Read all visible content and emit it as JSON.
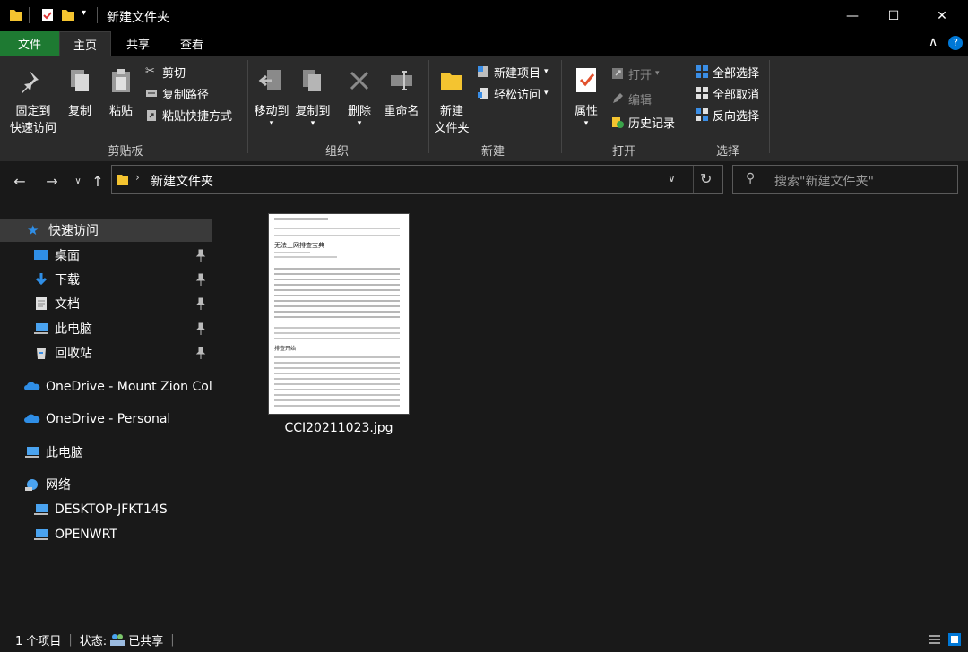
{
  "window": {
    "title": "新建文件夹",
    "controls": {
      "minimize": "—",
      "maximize": "☐",
      "close": "✕"
    }
  },
  "tabs": [
    {
      "label": "文件"
    },
    {
      "label": "主页"
    },
    {
      "label": "共享"
    },
    {
      "label": "查看"
    }
  ],
  "ribbon": {
    "clipboard": {
      "pin_label": "固定到\n快速访问",
      "copy_label": "复制",
      "paste_label": "粘贴",
      "cut_label": "剪切",
      "copy_path_label": "复制路径",
      "paste_shortcut_label": "粘贴快捷方式",
      "group_label": "剪贴板"
    },
    "organize": {
      "move_to_label": "移动到",
      "copy_to_label": "复制到",
      "delete_label": "删除",
      "rename_label": "重命名",
      "group_label": "组织"
    },
    "new": {
      "new_folder_label": "新建\n文件夹",
      "new_item_label": "新建项目",
      "easy_access_label": "轻松访问",
      "group_label": "新建"
    },
    "open": {
      "properties_label": "属性",
      "open_label": "打开",
      "edit_label": "编辑",
      "history_label": "历史记录",
      "group_label": "打开"
    },
    "select": {
      "select_all_label": "全部选择",
      "select_none_label": "全部取消",
      "invert_label": "反向选择",
      "group_label": "选择"
    }
  },
  "address": {
    "path": "新建文件夹",
    "search_placeholder": "搜索\"新建文件夹\""
  },
  "nav": {
    "quick_access": "快速访问",
    "desktop": "桌面",
    "downloads": "下载",
    "documents": "文档",
    "this_pc_pinned": "此电脑",
    "recycle_bin": "回收站",
    "onedrive_org": "OneDrive - Mount Zion Coll",
    "onedrive_personal": "OneDrive - Personal",
    "this_pc": "此电脑",
    "network": "网络",
    "desktop_host": "DESKTOP-JFKT14S",
    "openwrt": "OPENWRT"
  },
  "files": [
    {
      "name": "CCI20211023.jpg"
    }
  ],
  "thumbnail_text": {
    "heading": "无法上网排查宝典",
    "section": "排查开始"
  },
  "status": {
    "count": "1 个项目",
    "state_label": "状态:",
    "shared": "已共享"
  },
  "colors": {
    "file_tab": "#1e7a32",
    "accent": "#0078d7",
    "folder": "#f4c430"
  }
}
